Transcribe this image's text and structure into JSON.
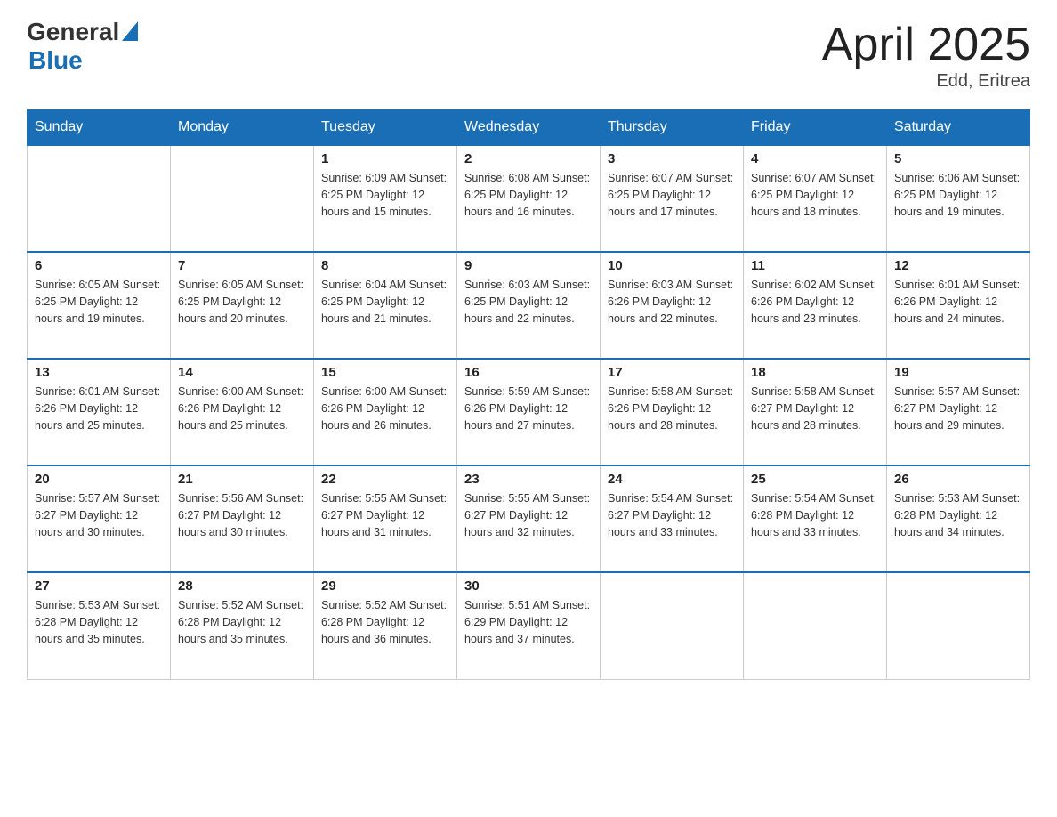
{
  "header": {
    "logo_general": "General",
    "logo_blue": "Blue",
    "title": "April 2025",
    "subtitle": "Edd, Eritrea"
  },
  "days_of_week": [
    "Sunday",
    "Monday",
    "Tuesday",
    "Wednesday",
    "Thursday",
    "Friday",
    "Saturday"
  ],
  "weeks": [
    [
      {
        "day": "",
        "info": ""
      },
      {
        "day": "",
        "info": ""
      },
      {
        "day": "1",
        "info": "Sunrise: 6:09 AM\nSunset: 6:25 PM\nDaylight: 12 hours\nand 15 minutes."
      },
      {
        "day": "2",
        "info": "Sunrise: 6:08 AM\nSunset: 6:25 PM\nDaylight: 12 hours\nand 16 minutes."
      },
      {
        "day": "3",
        "info": "Sunrise: 6:07 AM\nSunset: 6:25 PM\nDaylight: 12 hours\nand 17 minutes."
      },
      {
        "day": "4",
        "info": "Sunrise: 6:07 AM\nSunset: 6:25 PM\nDaylight: 12 hours\nand 18 minutes."
      },
      {
        "day": "5",
        "info": "Sunrise: 6:06 AM\nSunset: 6:25 PM\nDaylight: 12 hours\nand 19 minutes."
      }
    ],
    [
      {
        "day": "6",
        "info": "Sunrise: 6:05 AM\nSunset: 6:25 PM\nDaylight: 12 hours\nand 19 minutes."
      },
      {
        "day": "7",
        "info": "Sunrise: 6:05 AM\nSunset: 6:25 PM\nDaylight: 12 hours\nand 20 minutes."
      },
      {
        "day": "8",
        "info": "Sunrise: 6:04 AM\nSunset: 6:25 PM\nDaylight: 12 hours\nand 21 minutes."
      },
      {
        "day": "9",
        "info": "Sunrise: 6:03 AM\nSunset: 6:25 PM\nDaylight: 12 hours\nand 22 minutes."
      },
      {
        "day": "10",
        "info": "Sunrise: 6:03 AM\nSunset: 6:26 PM\nDaylight: 12 hours\nand 22 minutes."
      },
      {
        "day": "11",
        "info": "Sunrise: 6:02 AM\nSunset: 6:26 PM\nDaylight: 12 hours\nand 23 minutes."
      },
      {
        "day": "12",
        "info": "Sunrise: 6:01 AM\nSunset: 6:26 PM\nDaylight: 12 hours\nand 24 minutes."
      }
    ],
    [
      {
        "day": "13",
        "info": "Sunrise: 6:01 AM\nSunset: 6:26 PM\nDaylight: 12 hours\nand 25 minutes."
      },
      {
        "day": "14",
        "info": "Sunrise: 6:00 AM\nSunset: 6:26 PM\nDaylight: 12 hours\nand 25 minutes."
      },
      {
        "day": "15",
        "info": "Sunrise: 6:00 AM\nSunset: 6:26 PM\nDaylight: 12 hours\nand 26 minutes."
      },
      {
        "day": "16",
        "info": "Sunrise: 5:59 AM\nSunset: 6:26 PM\nDaylight: 12 hours\nand 27 minutes."
      },
      {
        "day": "17",
        "info": "Sunrise: 5:58 AM\nSunset: 6:26 PM\nDaylight: 12 hours\nand 28 minutes."
      },
      {
        "day": "18",
        "info": "Sunrise: 5:58 AM\nSunset: 6:27 PM\nDaylight: 12 hours\nand 28 minutes."
      },
      {
        "day": "19",
        "info": "Sunrise: 5:57 AM\nSunset: 6:27 PM\nDaylight: 12 hours\nand 29 minutes."
      }
    ],
    [
      {
        "day": "20",
        "info": "Sunrise: 5:57 AM\nSunset: 6:27 PM\nDaylight: 12 hours\nand 30 minutes."
      },
      {
        "day": "21",
        "info": "Sunrise: 5:56 AM\nSunset: 6:27 PM\nDaylight: 12 hours\nand 30 minutes."
      },
      {
        "day": "22",
        "info": "Sunrise: 5:55 AM\nSunset: 6:27 PM\nDaylight: 12 hours\nand 31 minutes."
      },
      {
        "day": "23",
        "info": "Sunrise: 5:55 AM\nSunset: 6:27 PM\nDaylight: 12 hours\nand 32 minutes."
      },
      {
        "day": "24",
        "info": "Sunrise: 5:54 AM\nSunset: 6:27 PM\nDaylight: 12 hours\nand 33 minutes."
      },
      {
        "day": "25",
        "info": "Sunrise: 5:54 AM\nSunset: 6:28 PM\nDaylight: 12 hours\nand 33 minutes."
      },
      {
        "day": "26",
        "info": "Sunrise: 5:53 AM\nSunset: 6:28 PM\nDaylight: 12 hours\nand 34 minutes."
      }
    ],
    [
      {
        "day": "27",
        "info": "Sunrise: 5:53 AM\nSunset: 6:28 PM\nDaylight: 12 hours\nand 35 minutes."
      },
      {
        "day": "28",
        "info": "Sunrise: 5:52 AM\nSunset: 6:28 PM\nDaylight: 12 hours\nand 35 minutes."
      },
      {
        "day": "29",
        "info": "Sunrise: 5:52 AM\nSunset: 6:28 PM\nDaylight: 12 hours\nand 36 minutes."
      },
      {
        "day": "30",
        "info": "Sunrise: 5:51 AM\nSunset: 6:29 PM\nDaylight: 12 hours\nand 37 minutes."
      },
      {
        "day": "",
        "info": ""
      },
      {
        "day": "",
        "info": ""
      },
      {
        "day": "",
        "info": ""
      }
    ]
  ]
}
